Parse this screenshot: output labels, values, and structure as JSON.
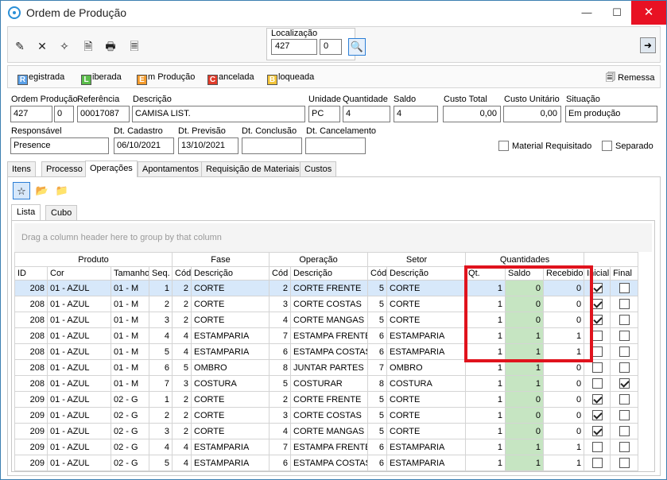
{
  "window": {
    "title": "Ordem de Produção"
  },
  "toolbar": {
    "icons": [
      "edit-icon",
      "delete-icon",
      "magic-icon",
      "preview-icon",
      "print-icon",
      "document-icon"
    ],
    "localizacao": {
      "label": "Localização",
      "value1": "427",
      "value2": "0"
    }
  },
  "status_buttons": [
    {
      "key": "R",
      "rest": "egistrada",
      "color": "#5aa0e8"
    },
    {
      "key": "L",
      "rest": "iberada",
      "color": "#5bbd4b"
    },
    {
      "key": "E",
      "rest": "m Produção",
      "color": "#f39a2b"
    },
    {
      "key": "C",
      "rest": "ancelada",
      "color": "#e23b2a"
    },
    {
      "key": "B",
      "rest": "loqueada",
      "color": "#f2c438"
    }
  ],
  "remessa_label": "Remessa",
  "form": {
    "ordem_producao": {
      "label": "Ordem Produção",
      "value1": "427",
      "value2": "0"
    },
    "referencia": {
      "label": "Referência",
      "value": "00017087"
    },
    "descricao": {
      "label": "Descrição",
      "value": "CAMISA LIST."
    },
    "unidade": {
      "label": "Unidade",
      "value": "PC"
    },
    "quantidade": {
      "label": "Quantidade",
      "value": "4"
    },
    "saldo": {
      "label": "Saldo",
      "value": "4"
    },
    "custo_total": {
      "label": "Custo Total",
      "value": "0,00"
    },
    "custo_unitario": {
      "label": "Custo Unitário",
      "value": "0,00"
    },
    "situacao": {
      "label": "Situação",
      "value": "Em produção"
    },
    "responsavel": {
      "label": "Responsável",
      "value": "Presence"
    },
    "dt_cadastro": {
      "label": "Dt. Cadastro",
      "value": "06/10/2021"
    },
    "dt_previsao": {
      "label": "Dt. Previsão",
      "value": "13/10/2021"
    },
    "dt_conclusao": {
      "label": "Dt. Conclusão",
      "value": ""
    },
    "dt_cancelamento": {
      "label": "Dt. Cancelamento",
      "value": ""
    },
    "material_requisitado": {
      "label": "Material Requisitado",
      "checked": false
    },
    "separado": {
      "label": "Separado",
      "checked": false
    }
  },
  "tabs": [
    "Itens",
    "Processo",
    "Operações",
    "Apontamentos",
    "Requisição de Materiais",
    "Custos"
  ],
  "active_tab": "Operações",
  "subtabs": [
    "Lista",
    "Cubo"
  ],
  "grid": {
    "group_hint": "Drag a column header here to group by that column",
    "bands": [
      "Produto",
      "Fase",
      "Operação",
      "Setor",
      "Quantidades"
    ],
    "columns": [
      "ID",
      "Cor",
      "Tamanho",
      "Seq.",
      "Cód",
      "Descrição",
      "Cód",
      "Descrição",
      "Cód",
      "Descrição",
      "Qt.",
      "Saldo",
      "Recebido",
      "Inicial",
      "Final"
    ],
    "rows": [
      {
        "id": "208",
        "cor": "01 - AZUL",
        "tam": "01 - M",
        "seq": "1",
        "fcod": "2",
        "fdesc": "CORTE",
        "ocod": "2",
        "odesc": "CORTE FRENTE",
        "scod": "5",
        "sdesc": "CORTE",
        "qt": "1",
        "saldo": "0",
        "receb": "0",
        "inicial": true,
        "final": false
      },
      {
        "id": "208",
        "cor": "01 - AZUL",
        "tam": "01 - M",
        "seq": "2",
        "fcod": "2",
        "fdesc": "CORTE",
        "ocod": "3",
        "odesc": "CORTE COSTAS",
        "scod": "5",
        "sdesc": "CORTE",
        "qt": "1",
        "saldo": "0",
        "receb": "0",
        "inicial": true,
        "final": false
      },
      {
        "id": "208",
        "cor": "01 - AZUL",
        "tam": "01 - M",
        "seq": "3",
        "fcod": "2",
        "fdesc": "CORTE",
        "ocod": "4",
        "odesc": "CORTE MANGAS",
        "scod": "5",
        "sdesc": "CORTE",
        "qt": "1",
        "saldo": "0",
        "receb": "0",
        "inicial": true,
        "final": false
      },
      {
        "id": "208",
        "cor": "01 - AZUL",
        "tam": "01 - M",
        "seq": "4",
        "fcod": "4",
        "fdesc": "ESTAMPARIA",
        "ocod": "7",
        "odesc": "ESTAMPA FRENTE",
        "scod": "6",
        "sdesc": "ESTAMPARIA",
        "qt": "1",
        "saldo": "1",
        "receb": "1",
        "inicial": false,
        "final": false
      },
      {
        "id": "208",
        "cor": "01 - AZUL",
        "tam": "01 - M",
        "seq": "5",
        "fcod": "4",
        "fdesc": "ESTAMPARIA",
        "ocod": "6",
        "odesc": "ESTAMPA COSTAS",
        "scod": "6",
        "sdesc": "ESTAMPARIA",
        "qt": "1",
        "saldo": "1",
        "receb": "1",
        "inicial": false,
        "final": false
      },
      {
        "id": "208",
        "cor": "01 - AZUL",
        "tam": "01 - M",
        "seq": "6",
        "fcod": "5",
        "fdesc": "OMBRO",
        "ocod": "8",
        "odesc": "JUNTAR PARTES",
        "scod": "7",
        "sdesc": "OMBRO",
        "qt": "1",
        "saldo": "1",
        "receb": "0",
        "inicial": false,
        "final": false
      },
      {
        "id": "208",
        "cor": "01 - AZUL",
        "tam": "01 - M",
        "seq": "7",
        "fcod": "3",
        "fdesc": "COSTURA",
        "ocod": "5",
        "odesc": "COSTURAR",
        "scod": "8",
        "sdesc": "COSTURA",
        "qt": "1",
        "saldo": "1",
        "receb": "0",
        "inicial": false,
        "final": true
      },
      {
        "id": "209",
        "cor": "01 - AZUL",
        "tam": "02 - G",
        "seq": "1",
        "fcod": "2",
        "fdesc": "CORTE",
        "ocod": "2",
        "odesc": "CORTE FRENTE",
        "scod": "5",
        "sdesc": "CORTE",
        "qt": "1",
        "saldo": "0",
        "receb": "0",
        "inicial": true,
        "final": false
      },
      {
        "id": "209",
        "cor": "01 - AZUL",
        "tam": "02 - G",
        "seq": "2",
        "fcod": "2",
        "fdesc": "CORTE",
        "ocod": "3",
        "odesc": "CORTE COSTAS",
        "scod": "5",
        "sdesc": "CORTE",
        "qt": "1",
        "saldo": "0",
        "receb": "0",
        "inicial": true,
        "final": false
      },
      {
        "id": "209",
        "cor": "01 - AZUL",
        "tam": "02 - G",
        "seq": "3",
        "fcod": "2",
        "fdesc": "CORTE",
        "ocod": "4",
        "odesc": "CORTE MANGAS",
        "scod": "5",
        "sdesc": "CORTE",
        "qt": "1",
        "saldo": "0",
        "receb": "0",
        "inicial": true,
        "final": false
      },
      {
        "id": "209",
        "cor": "01 - AZUL",
        "tam": "02 - G",
        "seq": "4",
        "fcod": "4",
        "fdesc": "ESTAMPARIA",
        "ocod": "7",
        "odesc": "ESTAMPA FRENTE",
        "scod": "6",
        "sdesc": "ESTAMPARIA",
        "qt": "1",
        "saldo": "1",
        "receb": "1",
        "inicial": false,
        "final": false
      },
      {
        "id": "209",
        "cor": "01 - AZUL",
        "tam": "02 - G",
        "seq": "5",
        "fcod": "4",
        "fdesc": "ESTAMPARIA",
        "ocod": "6",
        "odesc": "ESTAMPA COSTAS",
        "scod": "6",
        "sdesc": "ESTAMPARIA",
        "qt": "1",
        "saldo": "1",
        "receb": "1",
        "inicial": false,
        "final": false
      }
    ]
  }
}
